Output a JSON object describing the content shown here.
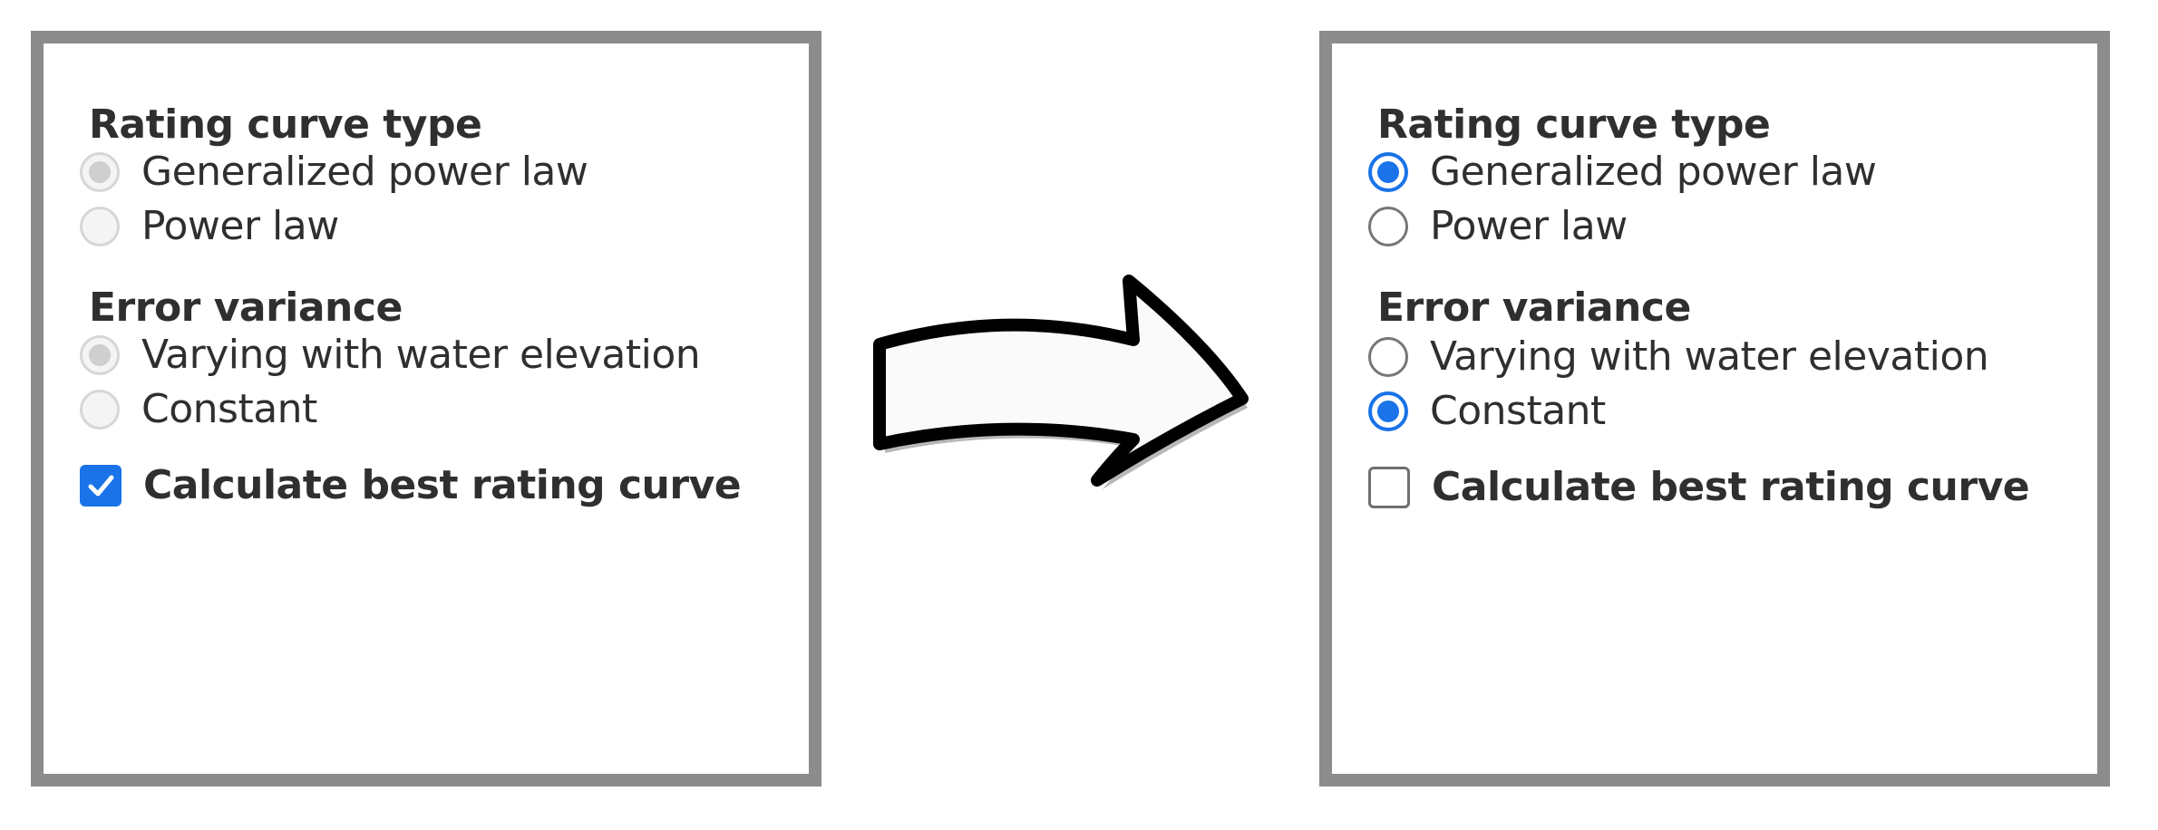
{
  "before": {
    "rating_curve_type": {
      "title": "Rating curve type",
      "options": [
        {
          "label": "Generalized power law",
          "checked": true,
          "disabled": true
        },
        {
          "label": "Power law",
          "checked": false,
          "disabled": true
        }
      ]
    },
    "error_variance": {
      "title": "Error variance",
      "options": [
        {
          "label": "Varying with water elevation",
          "checked": true,
          "disabled": true
        },
        {
          "label": "Constant",
          "checked": false,
          "disabled": true
        }
      ]
    },
    "calculate": {
      "label": "Calculate best rating curve",
      "checked": true
    }
  },
  "after": {
    "rating_curve_type": {
      "title": "Rating curve type",
      "options": [
        {
          "label": "Generalized power law",
          "checked": true,
          "disabled": false
        },
        {
          "label": "Power law",
          "checked": false,
          "disabled": false
        }
      ]
    },
    "error_variance": {
      "title": "Error variance",
      "options": [
        {
          "label": "Varying with water elevation",
          "checked": false,
          "disabled": false
        },
        {
          "label": "Constant",
          "checked": true,
          "disabled": false
        }
      ]
    },
    "calculate": {
      "label": "Calculate best rating curve",
      "checked": false
    }
  },
  "colors": {
    "accent": "#1a73e8",
    "panel_border": "#8c8c8c",
    "disabled_radio": "#cfcfcf",
    "text": "#2f2f2f"
  },
  "icons": {
    "transition": "right-arrow-icon",
    "check": "checkmark-icon"
  }
}
